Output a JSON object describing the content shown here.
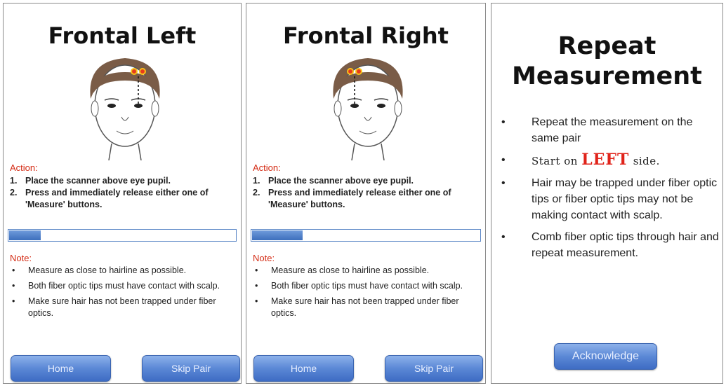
{
  "colors": {
    "accent_red": "#d42b14",
    "button_blue": "#5b88d6",
    "progress_blue": "#3d6fbd"
  },
  "panels": [
    {
      "title": "Frontal Left",
      "action_label": "Action:",
      "steps": [
        {
          "num": "1.",
          "text": "Place the scanner above eye pupil."
        },
        {
          "num": "2.",
          "text": "Press and immediately release  either one of 'Measure' buttons."
        }
      ],
      "progress": 0.14,
      "note_label": "Note:",
      "notes": [
        "Measure as close to hairline as possible.",
        "Both fiber optic tips must have contact with scalp.",
        "Make sure hair has not been trapped under fiber optics."
      ],
      "home_label": "Home",
      "skip_label": "Skip Pair"
    },
    {
      "title": "Frontal Right",
      "action_label": "Action:",
      "steps": [
        {
          "num": "1.",
          "text": "Place the scanner above eye pupil."
        },
        {
          "num": "2.",
          "text": "Press and immediately release  either one of 'Measure' buttons."
        }
      ],
      "progress": 0.22,
      "note_label": "Note:",
      "notes": [
        "Measure as close to hairline as possible.",
        "Both fiber optic tips must have contact with scalp.",
        "Make sure hair has not been trapped under fiber optics."
      ],
      "home_label": "Home",
      "skip_label": "Skip Pair"
    }
  ],
  "repeat": {
    "title_line1": "Repeat",
    "title_line2": "Measurement",
    "items": {
      "item1": "Repeat the measurement on the same pair",
      "item2_pre": "Start on ",
      "item2_emph": "LEFT",
      "item2_post": " side.",
      "item3": "Hair may be trapped under fiber optic tips or fiber optic tips may not be making contact with scalp.",
      "item4": "Comb fiber optic tips through hair and repeat measurement."
    },
    "acknowledge_label": "Acknowledge"
  }
}
